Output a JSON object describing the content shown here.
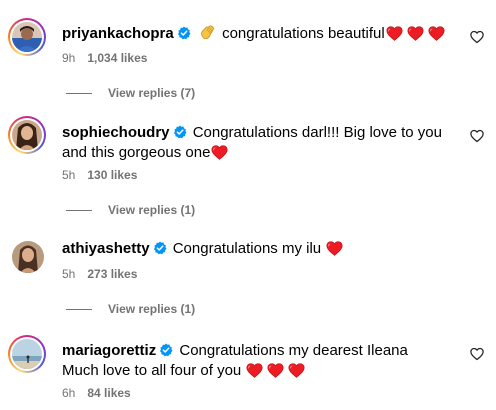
{
  "comments": [
    {
      "username": "priyankachopra",
      "text": "congratulations beautiful",
      "time": "9h",
      "likes": "1,034 likes",
      "view_replies": "View replies (7)"
    },
    {
      "username": "sophiechoudry",
      "text": "Congratulations darl!!! Big love to you and this gorgeous one",
      "time": "5h",
      "likes": "130 likes",
      "view_replies": "View replies (1)"
    },
    {
      "username": "athiyashetty",
      "text": "Congratulations my ilu",
      "time": "5h",
      "likes": "273 likes",
      "view_replies": "View replies (1)"
    },
    {
      "username": "mariagorettiz",
      "text_line1": "Congratulations my dearest Ileana",
      "text_line2": "Much love to all four of you",
      "time": "6h",
      "likes": "84 likes"
    }
  ],
  "icons": {
    "verified": "verified-badge-icon",
    "heart": "red-heart-emoji",
    "clap": "clapping-hands-emoji",
    "like": "heart-outline-icon"
  },
  "colors": {
    "verified": "#0095f6",
    "heart": "#ed1c24",
    "meta": "#737373"
  }
}
